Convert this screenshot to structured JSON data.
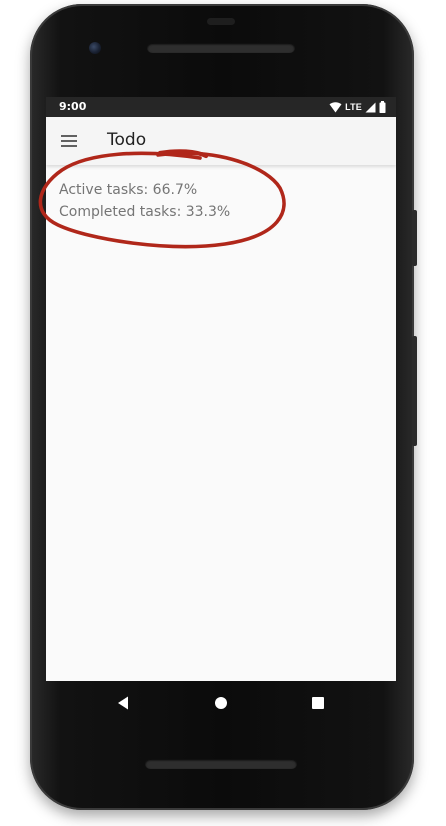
{
  "status_bar": {
    "time": "9:00",
    "network": "LTE",
    "icons": [
      "wifi-icon",
      "signal-icon",
      "battery-icon"
    ]
  },
  "app_bar": {
    "menu_icon": "hamburger-menu-icon",
    "title": "Todo"
  },
  "statistics": {
    "active": "Active tasks: 66.7%",
    "completed": "Completed tasks: 33.3%"
  },
  "navigation_bar": {
    "buttons": [
      "back-icon",
      "home-icon",
      "recents-icon"
    ]
  },
  "colors": {
    "status_bar": "#262626",
    "app_bar": "#f5f5f5",
    "background": "#fafafa",
    "stat_text": "#757575",
    "annotation": "#b0271a"
  }
}
